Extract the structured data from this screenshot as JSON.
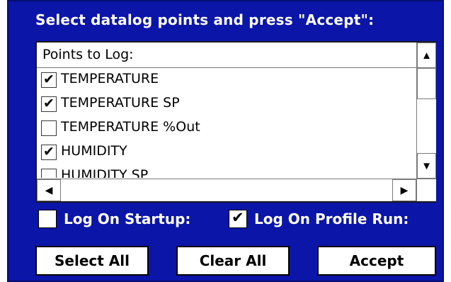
{
  "dialog": {
    "title": "Select datalog points and press \"Accept\":"
  },
  "list": {
    "header": "Points to Log:",
    "items": [
      {
        "label": "TEMPERATURE",
        "checked": true
      },
      {
        "label": "TEMPERATURE SP",
        "checked": true
      },
      {
        "label": "TEMPERATURE %Out",
        "checked": false
      },
      {
        "label": "HUMIDITY",
        "checked": true
      },
      {
        "label": "HUMIDITY SP",
        "checked": false
      }
    ]
  },
  "options": {
    "log_on_startup": {
      "label": "Log On Startup:",
      "checked": false
    },
    "log_on_profile_run": {
      "label": "Log On Profile Run:",
      "checked": true
    }
  },
  "buttons": {
    "select_all": "Select All",
    "clear_all": "Clear All",
    "accept": "Accept"
  },
  "colors": {
    "panel_background": "#0b15a8",
    "text_on_panel": "#ffffff"
  },
  "icons": {
    "scroll_up": "up-arrow-icon",
    "scroll_down": "down-arrow-icon",
    "scroll_left": "left-arrow-icon",
    "scroll_right": "right-arrow-icon",
    "check": "checkmark-icon"
  }
}
